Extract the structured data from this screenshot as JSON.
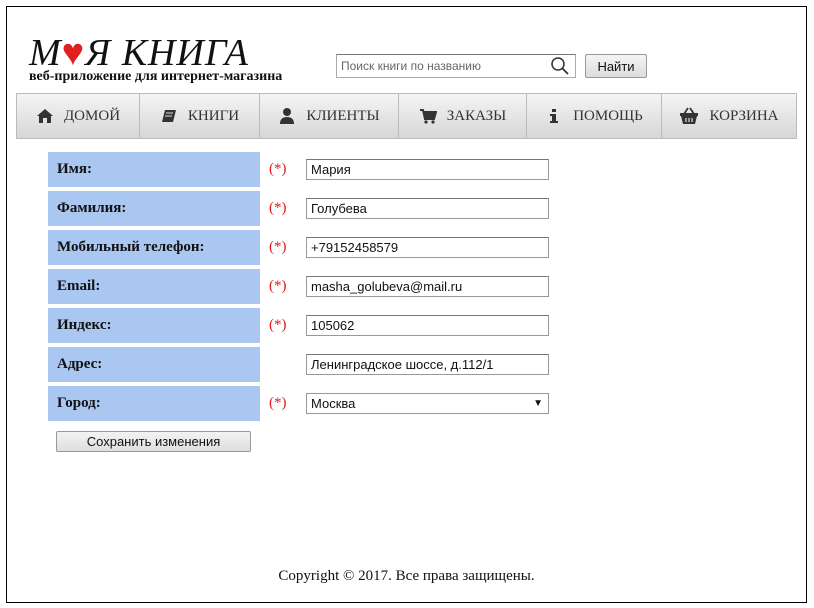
{
  "header": {
    "logo_title_pre": "М",
    "logo_heart": "♥",
    "logo_title_post": "Я КНИГА",
    "logo_subtitle": "веб-приложение для интернет-магазина",
    "search_placeholder": "Поиск книги по названию",
    "search_value": "",
    "find_label": "Найти"
  },
  "nav": {
    "items": [
      {
        "label": "ДОМОЙ",
        "icon": "home-icon"
      },
      {
        "label": "КНИГИ",
        "icon": "book-icon"
      },
      {
        "label": "КЛИЕНТЫ",
        "icon": "user-icon"
      },
      {
        "label": "ЗАКАЗЫ",
        "icon": "cart-icon"
      },
      {
        "label": "ПОМОЩЬ",
        "icon": "info-icon"
      },
      {
        "label": "КОРЗИНА",
        "icon": "basket-icon"
      }
    ]
  },
  "form": {
    "required_mark": "(*)",
    "first_name": {
      "label": "Имя:",
      "value": "Мария"
    },
    "last_name": {
      "label": "Фамилия:",
      "value": "Голубева"
    },
    "phone": {
      "label": "Мобильный телефон:",
      "value": "+79152458579"
    },
    "email": {
      "label": "Email:",
      "value": "masha_golubeva@mail.ru"
    },
    "zip": {
      "label": "Индекс:",
      "value": "105062"
    },
    "address": {
      "label": "Адрес:",
      "value": "Ленинградское шоссе, д.112/1"
    },
    "city": {
      "label": "Город:",
      "value": "Москва"
    },
    "save_label": "Сохранить изменения"
  },
  "footer": {
    "text": "Copyright © 2017. Все права защищены."
  },
  "colors": {
    "label_bg": "#a9c7f0",
    "required": "#e01a1a",
    "heart": "#e0201e"
  }
}
